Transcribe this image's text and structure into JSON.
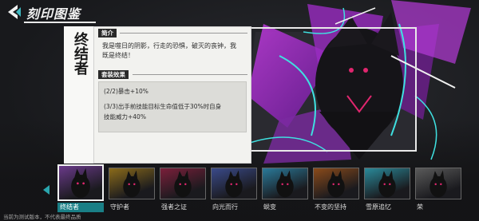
{
  "header": {
    "title": "刻印图鉴"
  },
  "hero": {
    "name": "终结者",
    "intro_tag": "简介",
    "intro_lines": [
      "我是噬日的阴影，行走的恐惧，破灭的丧钟，我",
      "既是终结！"
    ],
    "set_tag": "套装效果",
    "effects": [
      "(2/2)暴击+10%",
      "(3/3)出手前技能目标生命值低于30%时自身",
      "技能威力+40%"
    ]
  },
  "carousel": {
    "items": [
      {
        "label": "终结者",
        "selected": true,
        "color": "#6a3a8a"
      },
      {
        "label": "守护者",
        "selected": false,
        "color": "#8a6a1a"
      },
      {
        "label": "强者之证",
        "selected": false,
        "color": "#7a1f3a"
      },
      {
        "label": "向光而行",
        "selected": false,
        "color": "#3a4a8a"
      },
      {
        "label": "蜕变",
        "selected": false,
        "color": "#2a7a9a"
      },
      {
        "label": "不变的坚持",
        "selected": false,
        "color": "#8a4a1a"
      },
      {
        "label": "雪原追忆",
        "selected": false,
        "color": "#2a8a9a"
      },
      {
        "label": "荣",
        "selected": false,
        "color": "#5a5a5a"
      }
    ]
  },
  "footer": {
    "note": "当前为测试版本，不代表最终品质"
  },
  "colors": {
    "accent_teal": "#1a7f86",
    "art_purple": "#a02cc8",
    "art_cyan": "#3fe0e0",
    "art_magenta": "#e0266e"
  }
}
